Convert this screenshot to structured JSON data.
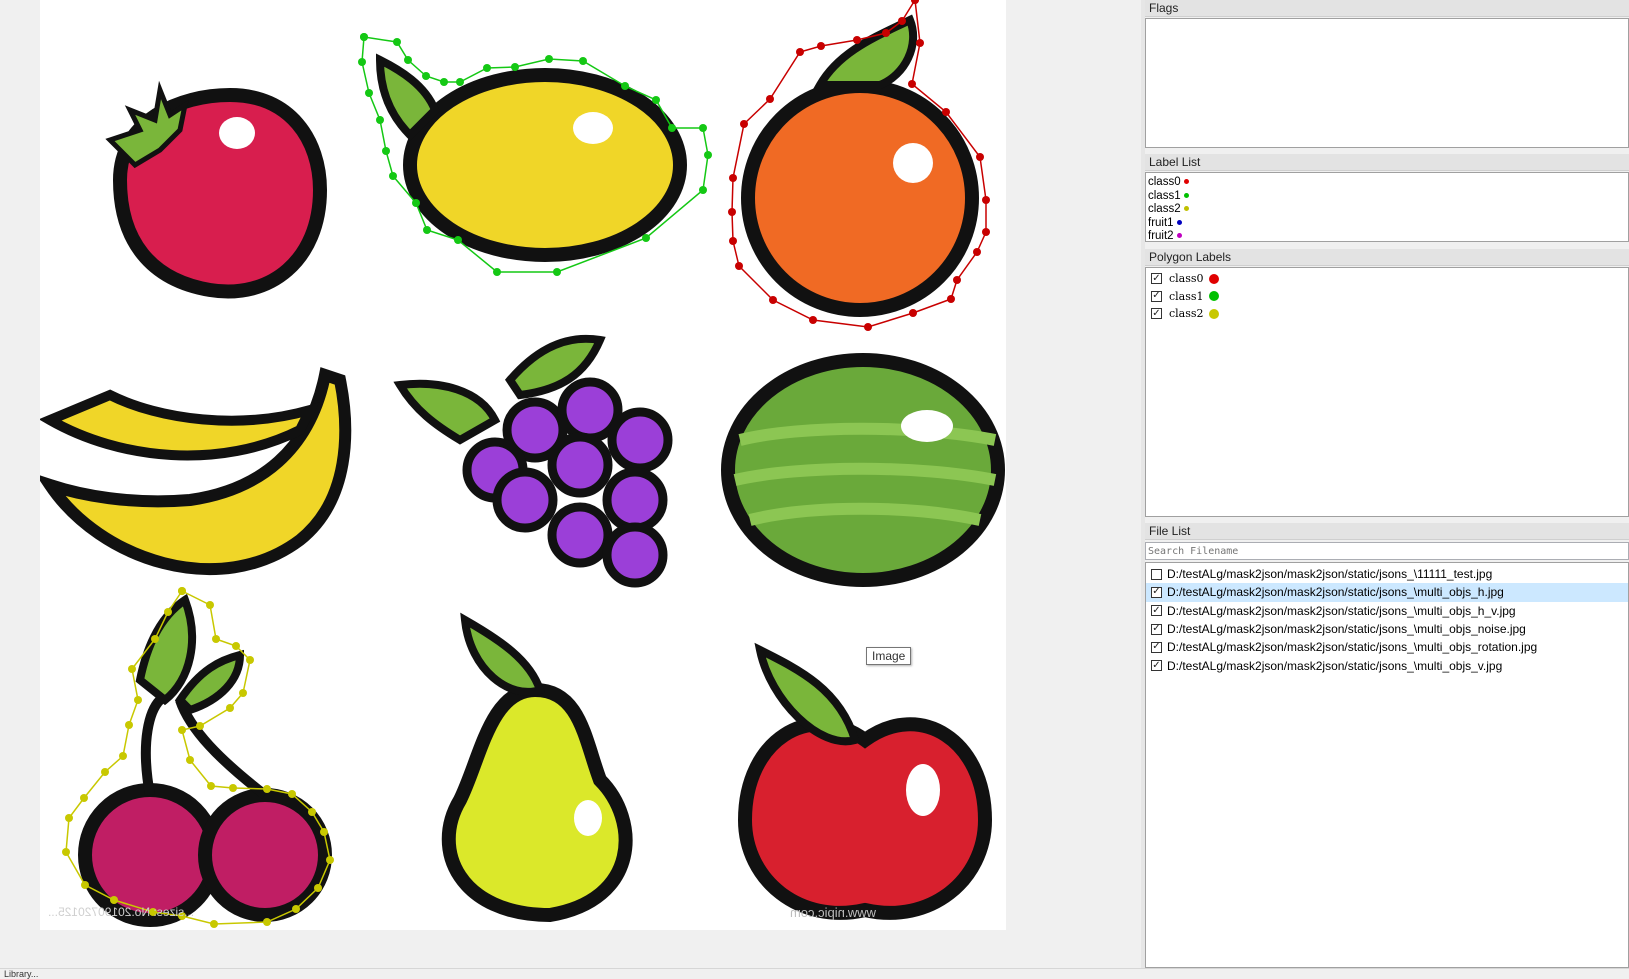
{
  "canvas": {
    "tooltip": "Image",
    "watermark_left": "...sizes: No.20190720125...",
    "watermark_right": "www.nipic.com",
    "shape_colors": {
      "class0": "#c80000",
      "class1": "#14c814",
      "class2": "#c8c800"
    }
  },
  "panels": {
    "flags": {
      "title": "Flags"
    },
    "label_list": {
      "title": "Label List",
      "items": [
        {
          "name": "class0",
          "color": "#e00000"
        },
        {
          "name": "class1",
          "color": "#00c000"
        },
        {
          "name": "class2",
          "color": "#c0c000"
        },
        {
          "name": "fruit1",
          "color": "#0000c0"
        },
        {
          "name": "fruit2",
          "color": "#c000c0"
        }
      ]
    },
    "polygon_labels": {
      "title": "Polygon Labels",
      "items": [
        {
          "name": "class0",
          "checked": true,
          "color": "#e00000"
        },
        {
          "name": "class1",
          "checked": true,
          "color": "#00c000"
        },
        {
          "name": "class2",
          "checked": true,
          "color": "#c8c800"
        }
      ]
    },
    "file_list": {
      "title": "File List",
      "search_placeholder": "Search Filename",
      "files": [
        {
          "path": "D:/testALg/mask2json/mask2json/static/jsons_\\11111_test.jpg",
          "checked": false,
          "selected": false
        },
        {
          "path": "D:/testALg/mask2json/mask2json/static/jsons_\\multi_objs_h.jpg",
          "checked": true,
          "selected": true
        },
        {
          "path": "D:/testALg/mask2json/mask2json/static/jsons_\\multi_objs_h_v.jpg",
          "checked": true,
          "selected": false
        },
        {
          "path": "D:/testALg/mask2json/mask2json/static/jsons_\\multi_objs_noise.jpg",
          "checked": true,
          "selected": false
        },
        {
          "path": "D:/testALg/mask2json/mask2json/static/jsons_\\multi_objs_rotation.jpg",
          "checked": true,
          "selected": false
        },
        {
          "path": "D:/testALg/mask2json/mask2json/static/jsons_\\multi_objs_v.jpg",
          "checked": true,
          "selected": false
        }
      ]
    }
  },
  "status": {
    "text": "Library..."
  }
}
